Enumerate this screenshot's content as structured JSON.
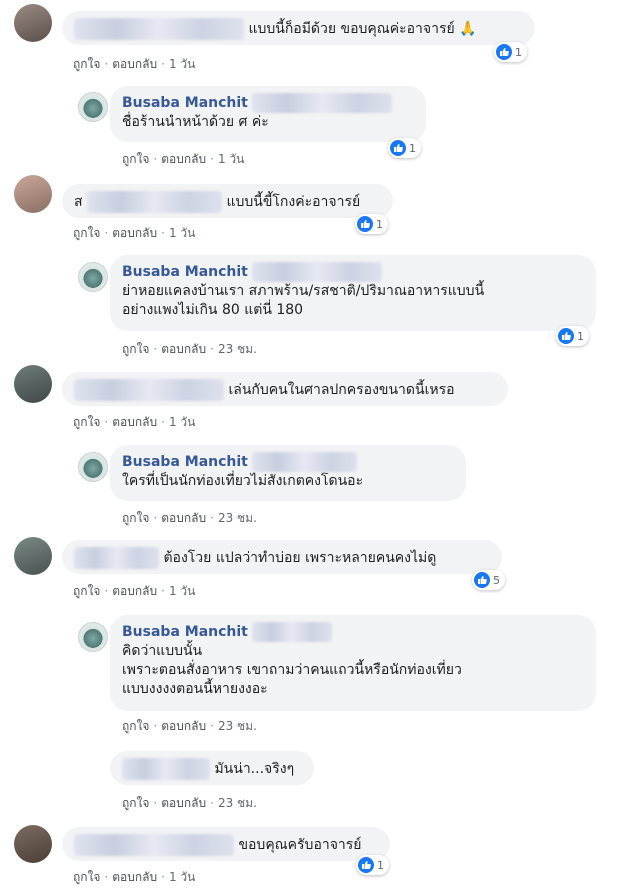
{
  "actions": {
    "like": "ถูกใจ",
    "reply": "ตอบกลับ",
    "sep": "·"
  },
  "comments": [
    {
      "text": "แบบนี้ก็อมีด้วย ขอบคุณค่ะอาจารย์ 🙏",
      "time": "1 วัน",
      "reactions": "1"
    },
    {
      "name": "Busaba Manchit",
      "text": "ชื่อร้านนำหน้าด้วย ศ ค่ะ",
      "time": "1 วัน",
      "reactions": "1"
    },
    {
      "prefix": "ส",
      "text": "แบบนี้ขี้โกงค่ะอาจารย์",
      "time": "1 วัน",
      "reactions": "1"
    },
    {
      "name": "Busaba Manchit",
      "text": "ย่าหอยแคลงบ้านเรา สภาพร้าน/รสชาติ/ปริมาณอาหารแบบนี้\nอย่างแพงไม่เกิน 80 แต่นี่ 180",
      "time": "23 ชม.",
      "reactions": "1"
    },
    {
      "text": "เล่นกับคนในศาลปกครองขนาดนี้เหรอ",
      "time": "1 วัน"
    },
    {
      "name": "Busaba Manchit",
      "text": "ใครที่เป็นนักท่องเที่ยวไม่สังเกตคงโดนอะ",
      "time": "23 ชม."
    },
    {
      "text": "ต้องโวย แปลว่าทำบ่อย เพราะหลายคนคงไม่ดู",
      "time": "1 วัน",
      "reactions": "5"
    },
    {
      "name": "Busaba Manchit",
      "text": "คิดว่าแบบนั้น\nเพราะตอนสั่งอาหาร เขาถามว่าคนแถวนี้หรือนักท่องเที่ยว\nแบบงงงงตอนนี้หายงงอะ",
      "time": "23 ชม."
    },
    {
      "text": "มันน่า...จริงๆ",
      "time": "23 ชม."
    },
    {
      "text": "ขอบคุณครับอาจารย์",
      "time": "1 วัน",
      "reactions": "1"
    }
  ]
}
